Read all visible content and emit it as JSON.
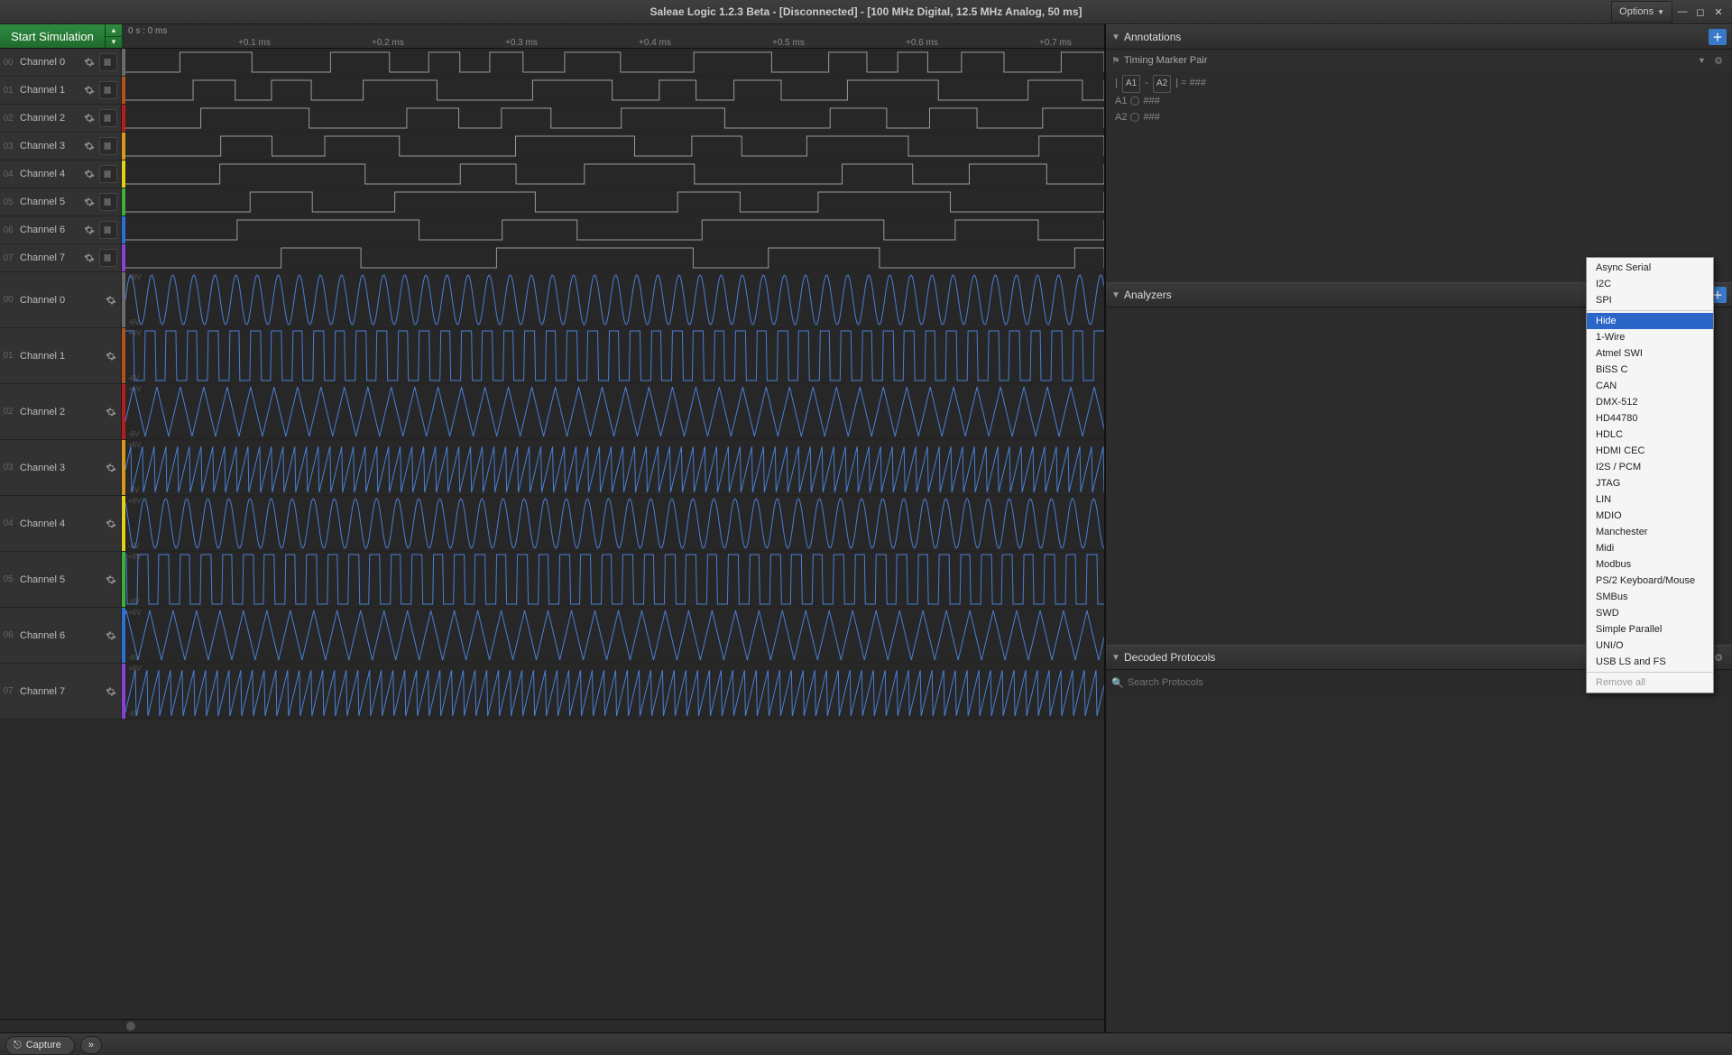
{
  "titlebar": {
    "title": "Saleae Logic 1.2.3 Beta - [Disconnected] - [100 MHz Digital, 12.5 MHz Analog, 50 ms]",
    "options_label": "Options"
  },
  "simulation": {
    "button_label": "Start Simulation"
  },
  "ruler": {
    "origin": "0 s : 0 ms",
    "ticks": [
      "+0.1 ms",
      "+0.2 ms",
      "+0.3 ms",
      "+0.4 ms",
      "+0.5 ms",
      "+0.6 ms",
      "+0.7 ms"
    ]
  },
  "digital_channels": [
    {
      "idx": "00",
      "name": "Channel 0",
      "color": "#6b6b6b"
    },
    {
      "idx": "01",
      "name": "Channel 1",
      "color": "#b1521d"
    },
    {
      "idx": "02",
      "name": "Channel 2",
      "color": "#b81c1c"
    },
    {
      "idx": "03",
      "name": "Channel 3",
      "color": "#d99a1a"
    },
    {
      "idx": "04",
      "name": "Channel 4",
      "color": "#e3d01a"
    },
    {
      "idx": "05",
      "name": "Channel 5",
      "color": "#3fae3a"
    },
    {
      "idx": "06",
      "name": "Channel 6",
      "color": "#2e6fd6"
    },
    {
      "idx": "07",
      "name": "Channel 7",
      "color": "#8a3fd6"
    }
  ],
  "analog_channels": [
    {
      "idx": "00",
      "name": "Channel 0",
      "color": "#6b6b6b",
      "type": "sine"
    },
    {
      "idx": "01",
      "name": "Channel 1",
      "color": "#b1521d",
      "type": "square"
    },
    {
      "idx": "02",
      "name": "Channel 2",
      "color": "#b81c1c",
      "type": "triangle"
    },
    {
      "idx": "03",
      "name": "Channel 3",
      "color": "#d99a1a",
      "type": "saw"
    },
    {
      "idx": "04",
      "name": "Channel 4",
      "color": "#e3d01a",
      "type": "sine"
    },
    {
      "idx": "05",
      "name": "Channel 5",
      "color": "#3fae3a",
      "type": "square"
    },
    {
      "idx": "06",
      "name": "Channel 6",
      "color": "#2e6fd6",
      "type": "triangle"
    },
    {
      "idx": "07",
      "name": "Channel 7",
      "color": "#8a3fd6",
      "type": "saw"
    }
  ],
  "analog_range": {
    "top": "+6V",
    "bot": "-6V"
  },
  "annotations": {
    "header": "Annotations",
    "marker_pair": "Timing Marker Pair",
    "line1_a": "A1",
    "line1_b": "A2",
    "line1_eq": " = ###",
    "line2": "A1",
    "line2_val": "###",
    "line3": "A2",
    "line3_val": "###"
  },
  "analyzers": {
    "header": "Analyzers",
    "menu": [
      "Async Serial",
      "I2C",
      "SPI",
      "Hide",
      "1-Wire",
      "Atmel SWI",
      "BiSS C",
      "CAN",
      "DMX-512",
      "HD44780",
      "HDLC",
      "HDMI CEC",
      "I2S / PCM",
      "JTAG",
      "LIN",
      "MDIO",
      "Manchester",
      "Midi",
      "Modbus",
      "PS/2 Keyboard/Mouse",
      "SMBus",
      "SWD",
      "Simple Parallel",
      "UNI/O",
      "USB LS and FS"
    ],
    "menu_remove": "Remove all",
    "highlighted_index": 3
  },
  "decoded": {
    "header": "Decoded Protocols",
    "search_placeholder": "Search Protocols"
  },
  "footer": {
    "capture_label": "Capture"
  }
}
